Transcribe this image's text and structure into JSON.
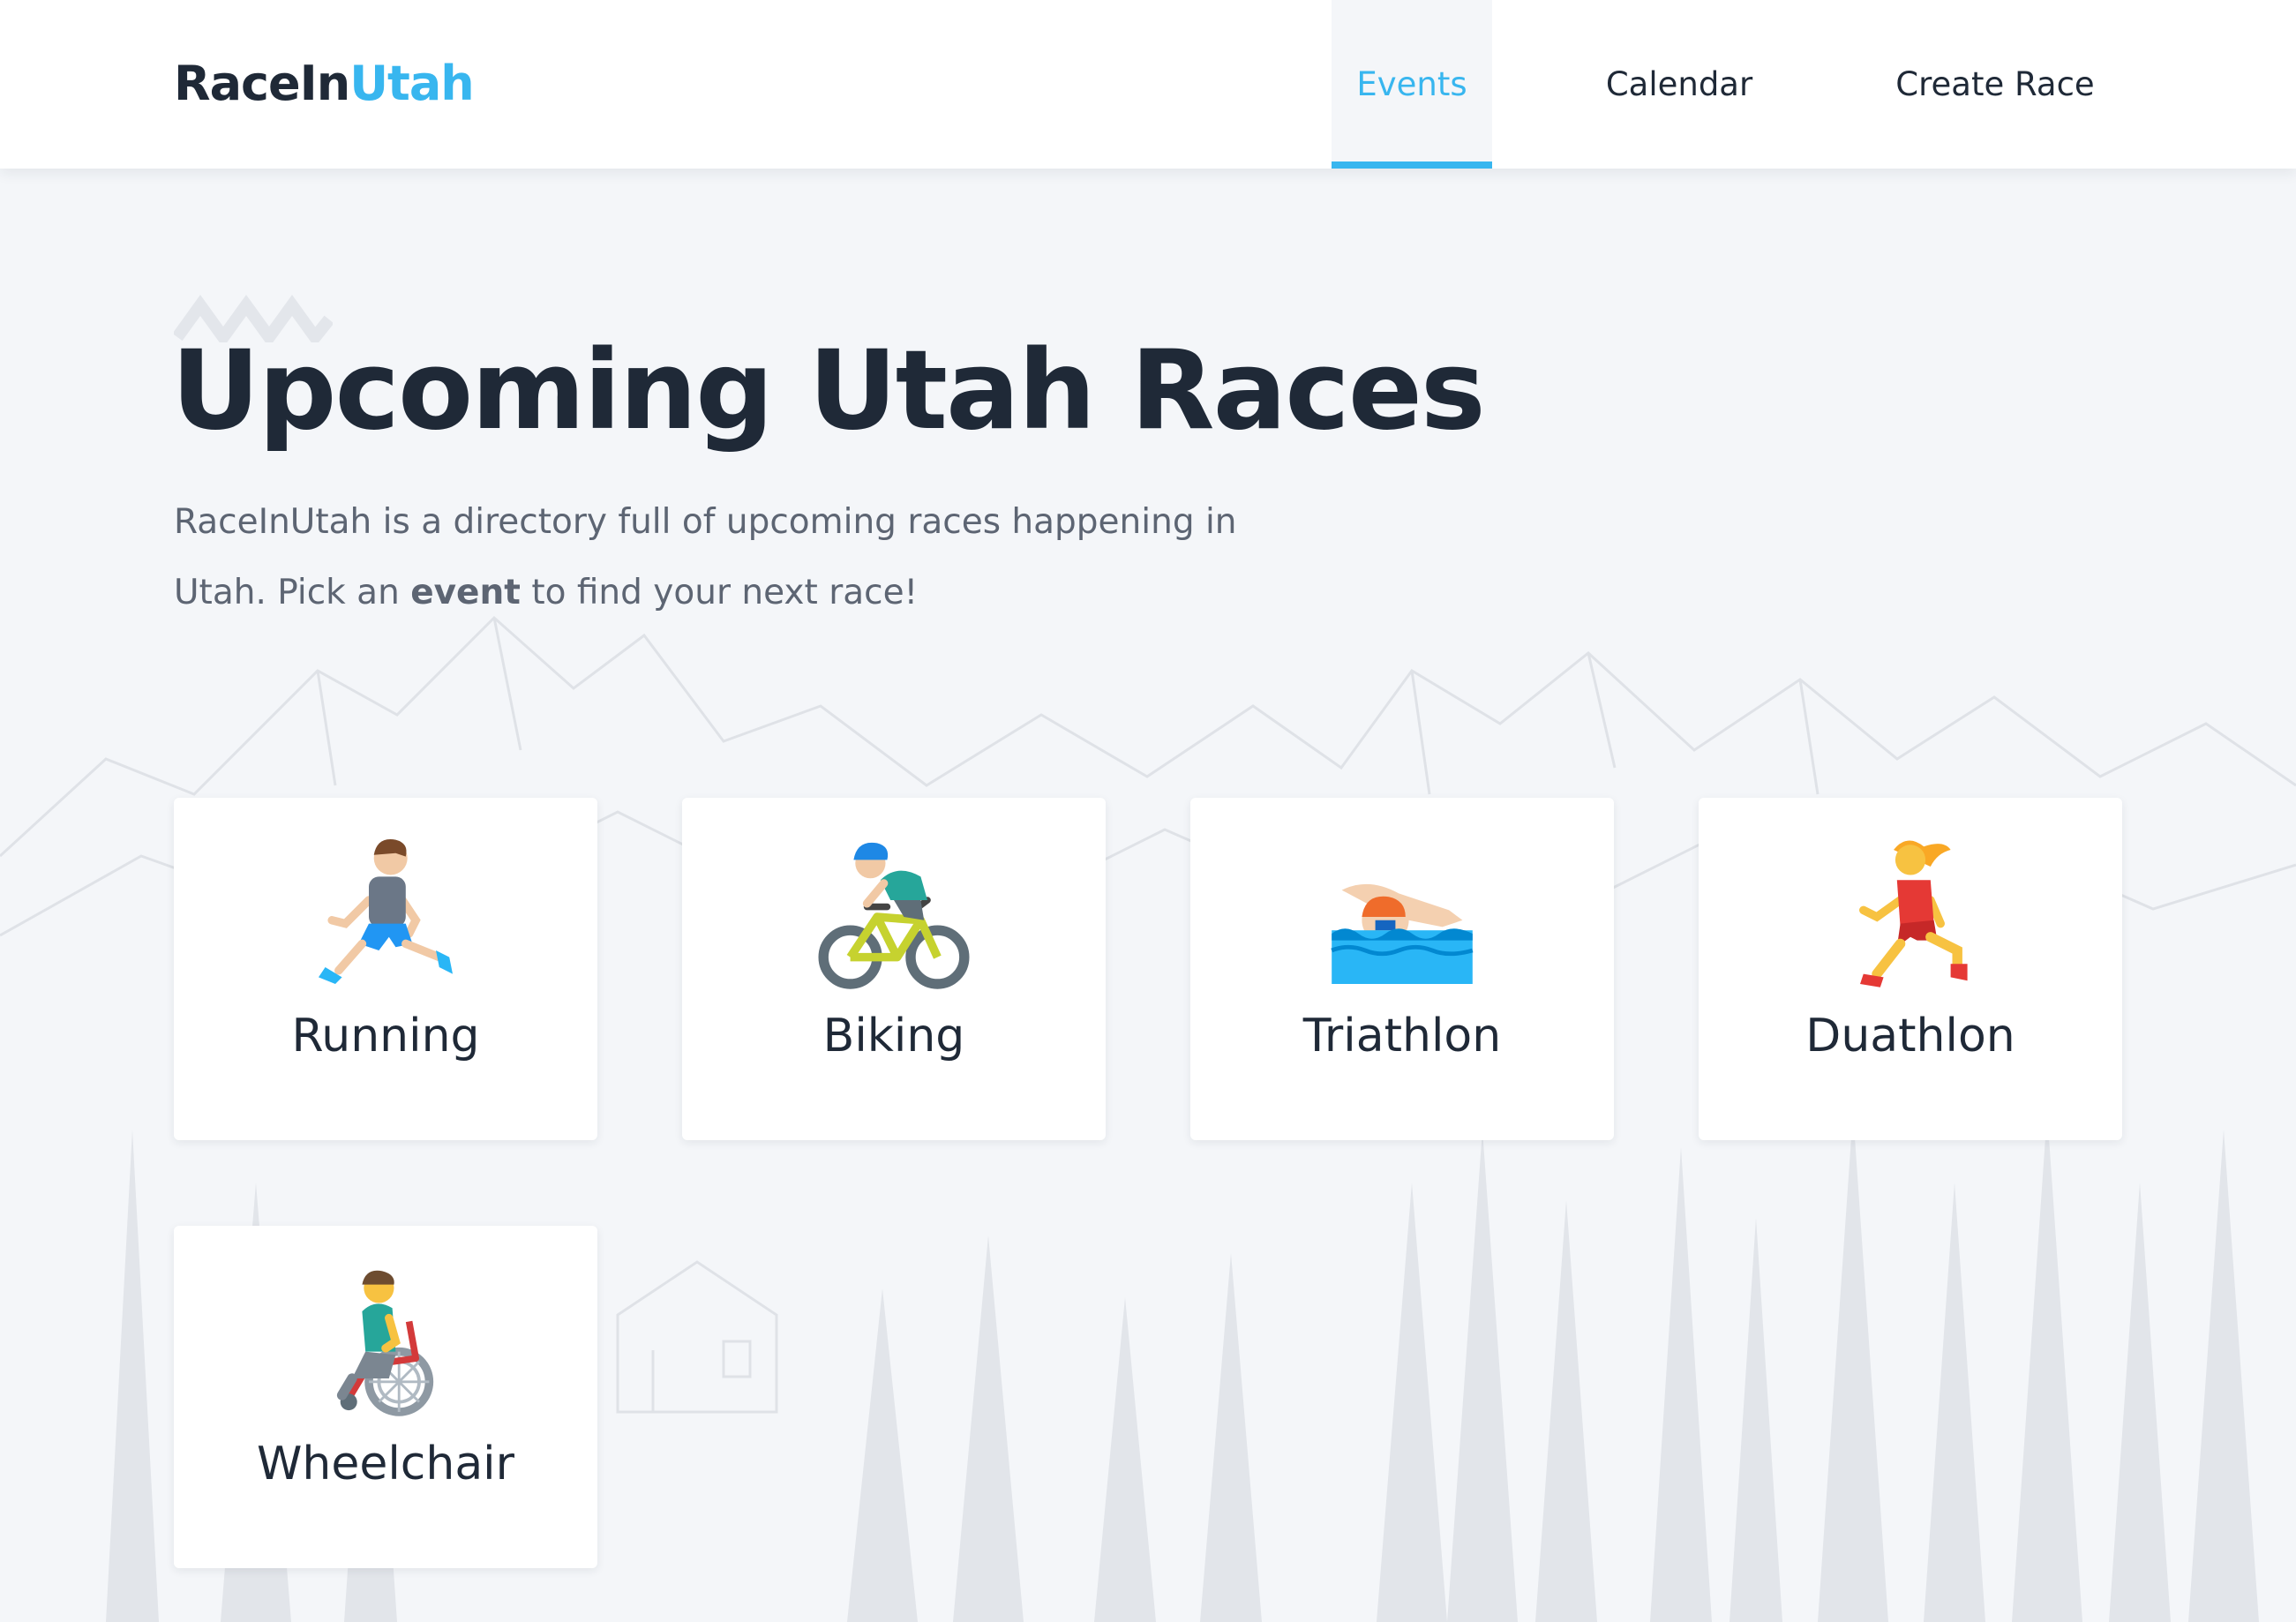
{
  "brand": {
    "part1": "RaceIn",
    "part2": "Utah"
  },
  "nav": {
    "events": "Events",
    "calendar": "Calendar",
    "create_race": "Create Race",
    "active": "events"
  },
  "hero": {
    "title": "Upcoming Utah Races",
    "intro_before": "RaceInUtah is a directory full of upcoming races happening in Utah. Pick an ",
    "intro_bold": "event",
    "intro_after": " to find your next race!"
  },
  "events": [
    {
      "label": "Running",
      "icon": "person-running-icon"
    },
    {
      "label": "Biking",
      "icon": "person-biking-icon"
    },
    {
      "label": "Triathlon",
      "icon": "person-swimming-icon"
    },
    {
      "label": "Duathlon",
      "icon": "woman-running-icon"
    },
    {
      "label": "Wheelchair",
      "icon": "person-in-wheelchair-icon"
    }
  ],
  "colors": {
    "accent": "#38b6ef",
    "text_dark": "#1f2937",
    "text_muted": "#5d6573",
    "background": "#f4f6f9",
    "card": "#ffffff"
  }
}
